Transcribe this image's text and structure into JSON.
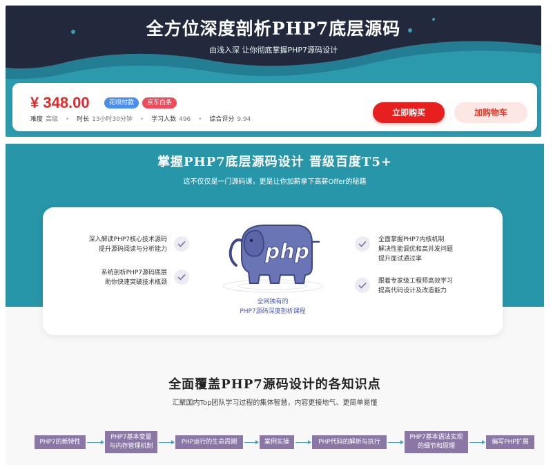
{
  "banner": {
    "title": "全方位深度剖析PHP7底层源码",
    "subtitle": "由浅入深 让你彻底掌握PHP7源码设计"
  },
  "purchase": {
    "price": "¥ 348.00",
    "tags": [
      "花呗付款",
      "京东白条"
    ],
    "meta": [
      {
        "label": "难度",
        "value": "高级"
      },
      {
        "label": "时长",
        "value": "13小时30分钟"
      },
      {
        "label": "学习人数",
        "value": "496"
      },
      {
        "label": "综合评分",
        "value": "9.94"
      }
    ],
    "buy_label": "立即购买",
    "cart_label": "加购物车"
  },
  "intro": {
    "title": "掌握PHP7底层源码设计  晋级百度T5+",
    "subtitle": "这不仅仅是一门源码课，更是让你加薪拿下高薪Offer的秘籍",
    "features_left": [
      {
        "line1": "深入解读PHP7核心技术源码",
        "line2": "提升源码阅读与分析能力"
      },
      {
        "line1": "系统剖析PHP7源码底层",
        "line2": "助你快速突破技术瓶颈"
      }
    ],
    "features_right": [
      {
        "line1": "全面掌握PHP7内核机制",
        "line2": "解决性能调优和高并发问题",
        "line3": "提升面试通过率"
      },
      {
        "line1": "跟着专家级工程师高效学习",
        "line2": "提高代码设计及改造能力",
        "line3": ""
      }
    ],
    "logo_text": "php",
    "caption_line1": "全网独有的",
    "caption_line2": "PHP7源码深度剖析课程"
  },
  "knowledge": {
    "title": "全面覆盖PHP7源码设计的各知识点",
    "subtitle": "汇聚国内Top团队学习过程的集体智慧，内容更接地气、更简单易懂",
    "flow": [
      {
        "line1": "PHP7的新特性",
        "line2": ""
      },
      {
        "line1": "PHP7基本变量",
        "line2": "与内存管理机制"
      },
      {
        "line1": "PHP运行的生命周期",
        "line2": ""
      },
      {
        "line1": "案例实操",
        "line2": ""
      },
      {
        "line1": "PHP代码的解析与执行",
        "line2": ""
      },
      {
        "line1": "PHP7基本语法实现",
        "line2": "的细节和原理"
      },
      {
        "line1": "编写PHP扩展",
        "line2": ""
      }
    ]
  },
  "colors": {
    "banner_dark": "#23293d",
    "teal": "#2796a9",
    "price_red": "#e02b2b",
    "buy_red": "#e81f1f",
    "flow_purple": "#8a77a6",
    "flow_arrow": "#4a9fc2",
    "elephant": "#6a75b5"
  },
  "icons": [
    "check-icon",
    "php-elephant-logo",
    "arrow-right-icon"
  ]
}
